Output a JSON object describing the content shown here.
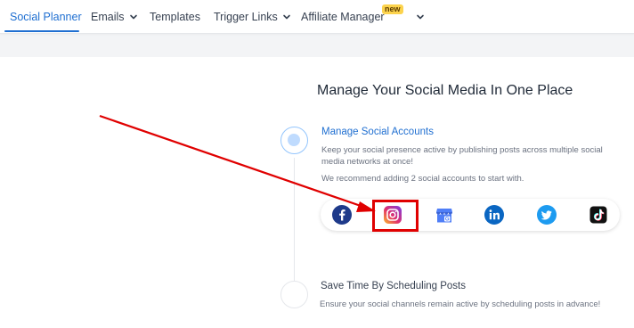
{
  "nav": {
    "items": [
      {
        "label": "Social Planner",
        "active": true
      },
      {
        "label": "Emails",
        "dropdown": true
      },
      {
        "label": "Templates"
      },
      {
        "label": "Trigger Links",
        "dropdown": true
      },
      {
        "label": "Affiliate Manager",
        "badge": "new",
        "dropdown": true
      }
    ],
    "active_color": "#1f6fd1",
    "badge_color": "#fcd34d"
  },
  "main": {
    "title": "Manage Your Social Media In One Place",
    "steps": [
      {
        "title": "Manage Social Accounts",
        "description": "Keep your social presence active by publishing posts across multiple social media networks at once!",
        "recommendation": "We recommend adding 2 social accounts to start with.",
        "active": true
      },
      {
        "title": "Save Time By Scheduling Posts",
        "description": "Ensure your social channels remain active by scheduling posts in advance!",
        "active": false
      }
    ],
    "social_icons": [
      "facebook-icon",
      "instagram-icon",
      "google-business-icon",
      "linkedin-icon",
      "twitter-icon",
      "tiktok-icon"
    ],
    "highlighted_icon": "instagram-icon",
    "annotation_color": "#e00000"
  }
}
